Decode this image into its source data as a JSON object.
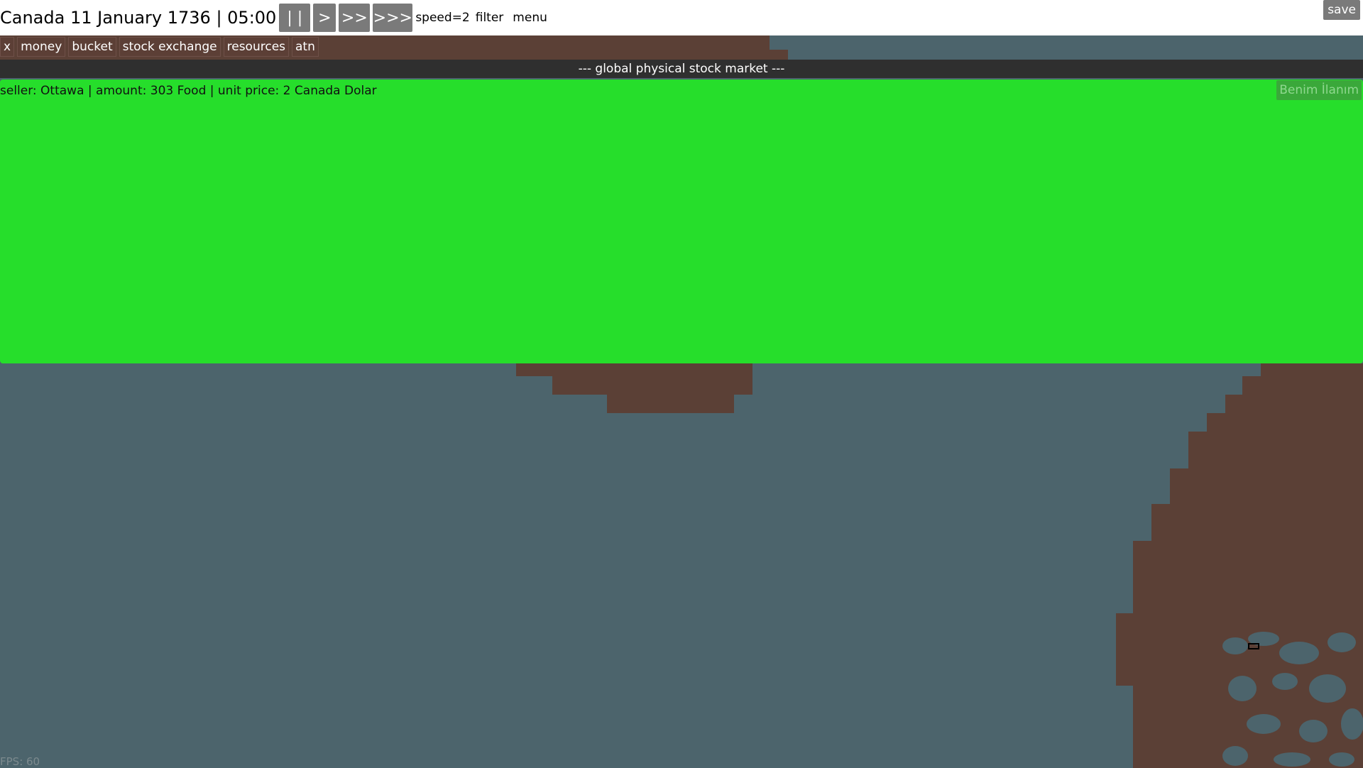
{
  "topbar": {
    "date_text": "Canada 11 January 1736 | 05:00",
    "pause_label": "| |",
    "play_label": ">",
    "fast_label": ">>",
    "faster_label": ">>>",
    "speed_text": "speed=2",
    "filter_label": "filter",
    "menu_label": "menu",
    "save_label": "save"
  },
  "tabs": [
    {
      "label": "x"
    },
    {
      "label": "money"
    },
    {
      "label": "bucket"
    },
    {
      "label": "stock exchange"
    },
    {
      "label": "resources"
    },
    {
      "label": "atn"
    }
  ],
  "market": {
    "header": "--- global physical stock market ---",
    "listing": "seller: Ottawa | amount: 303 Food | unit price: 2 Canada Dolar",
    "my_listing_label": "Benim İlanım"
  },
  "fps_text": "FPS: 60",
  "colors": {
    "water": "#4c646c",
    "land": "#5b4036",
    "market_green": "#26de2b",
    "topbar_bg": "#ffffff"
  }
}
